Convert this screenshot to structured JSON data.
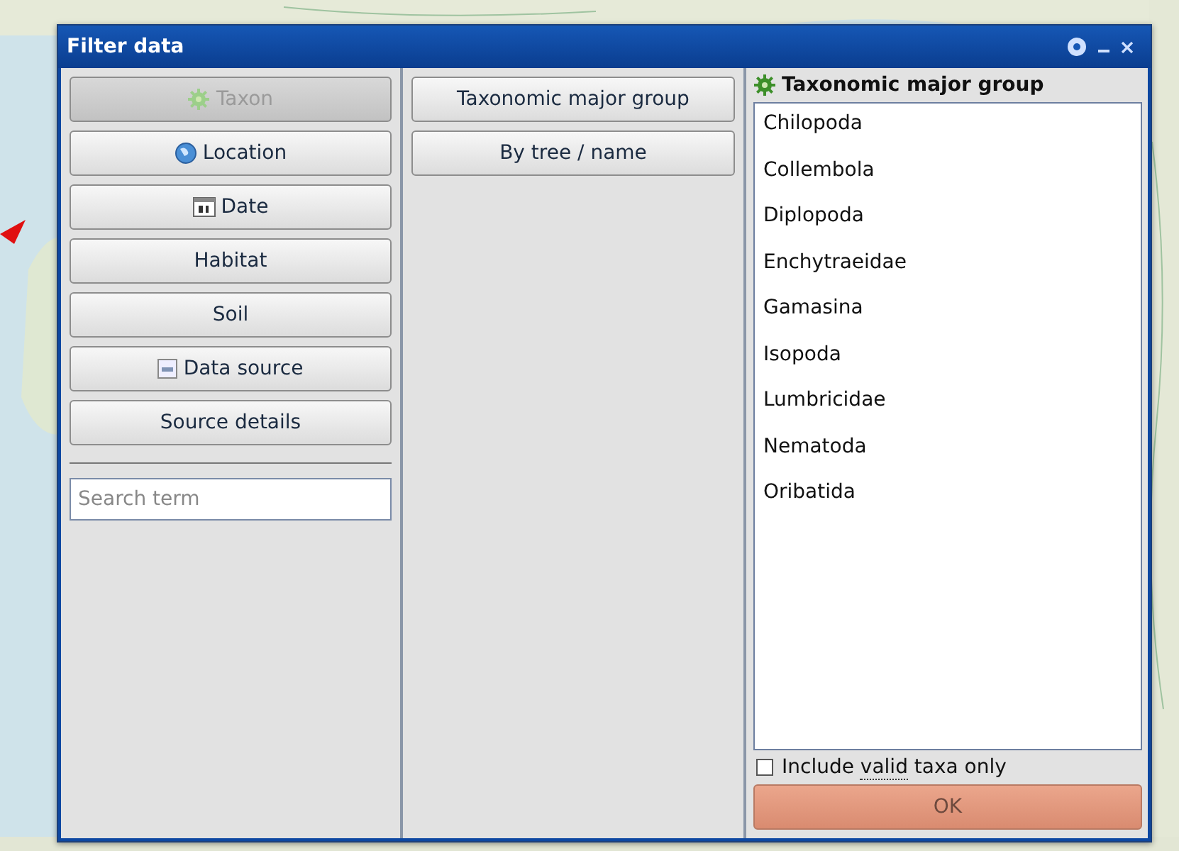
{
  "window": {
    "title": "Filter data"
  },
  "filter_buttons": [
    {
      "label": "Taxon",
      "disabled": true
    },
    {
      "label": "Location",
      "disabled": false
    },
    {
      "label": "Date",
      "disabled": false
    },
    {
      "label": "Habitat",
      "disabled": false
    },
    {
      "label": "Soil",
      "disabled": false
    },
    {
      "label": "Data source",
      "disabled": false
    },
    {
      "label": "Source details",
      "disabled": false
    }
  ],
  "search": {
    "placeholder": "Search term"
  },
  "sub_buttons": [
    {
      "label": "Taxonomic major group"
    },
    {
      "label": "By tree / name"
    }
  ],
  "panel": {
    "title": "Taxonomic major group",
    "items": [
      "Chilopoda",
      "Collembola",
      "Diplopoda",
      "Enchytraeidae",
      "Gamasina",
      "Isopoda",
      "Lumbricidae",
      "Nematoda",
      "Oribatida"
    ],
    "checkbox": {
      "parts": [
        "Include ",
        "valid",
        " taxa only"
      ],
      "checked": false
    },
    "ok": {
      "label": "OK",
      "disabled": true
    }
  }
}
